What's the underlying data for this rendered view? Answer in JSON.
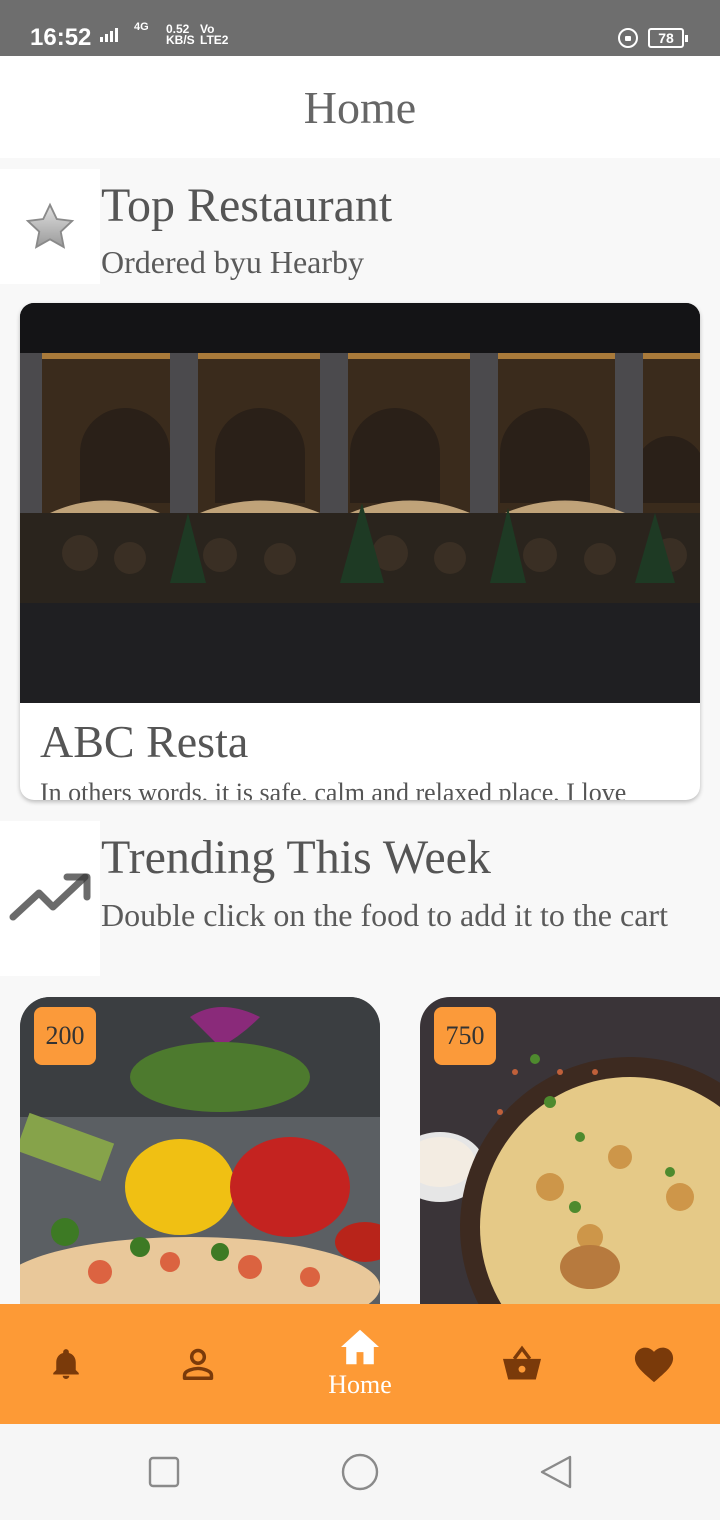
{
  "status_bar": {
    "time": "16:52",
    "network": "4G",
    "speed_value": "0.52",
    "speed_unit": "KB/S",
    "volte_top": "Vo",
    "volte_bottom": "LTE2",
    "battery": "78"
  },
  "app_bar": {
    "title": "Home"
  },
  "top_restaurant": {
    "title": "Top Restaurant",
    "subtitle": "Ordered byu Hearby",
    "icon": "star-icon",
    "card": {
      "name": "ABC Resta",
      "description": "In others words, it is safe, calm and relaxed place, I love"
    }
  },
  "trending": {
    "title": "Trending This Week",
    "subtitle": "Double click on the food to add it to the cart",
    "icon": "trending-up-icon",
    "items": [
      {
        "price": "200",
        "image": "pizza-vegetables-photo"
      },
      {
        "price": "750",
        "image": "biryani-photo"
      }
    ]
  },
  "bottom_nav": {
    "items": [
      {
        "icon": "bell-icon",
        "label": ""
      },
      {
        "icon": "person-icon",
        "label": ""
      },
      {
        "icon": "home-icon",
        "label": "Home"
      },
      {
        "icon": "basket-icon",
        "label": ""
      },
      {
        "icon": "heart-icon",
        "label": ""
      }
    ],
    "active_index": 2
  },
  "colors": {
    "accent": "#fd9a36",
    "nav_icon": "#7a3a0a",
    "status_bar": "#6e6e6e"
  }
}
